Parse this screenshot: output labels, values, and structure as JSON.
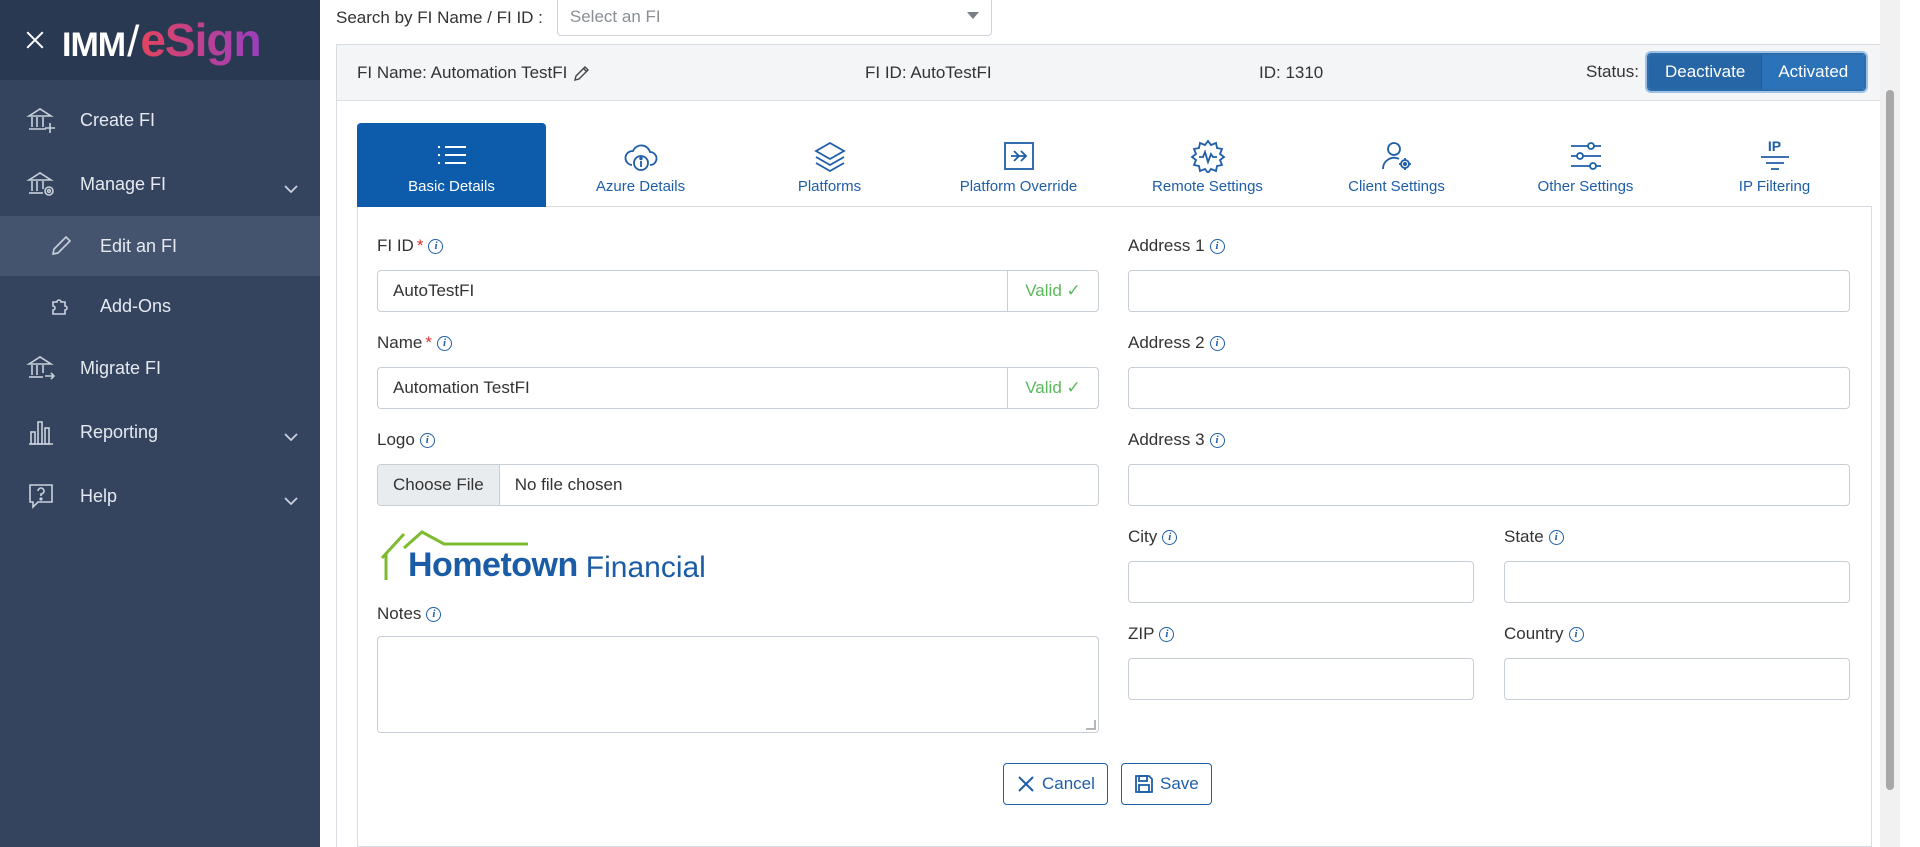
{
  "sidebar": {
    "brand": {
      "imm": "IMM",
      "slash": "/",
      "esign": "eSign"
    },
    "items": [
      {
        "label": "Create FI",
        "icon": "bank-plus-icon"
      },
      {
        "label": "Manage FI",
        "icon": "bank-gear-icon"
      },
      {
        "label": "Edit an FI",
        "icon": "pencil-icon"
      },
      {
        "label": "Add-Ons",
        "icon": "puzzle-icon"
      },
      {
        "label": "Migrate FI",
        "icon": "bank-arrow-icon"
      },
      {
        "label": "Reporting",
        "icon": "bar-chart-icon"
      },
      {
        "label": "Help",
        "icon": "help-bubble-icon"
      }
    ]
  },
  "search": {
    "label": "Search by FI Name / FI ID :",
    "placeholder": "Select an FI"
  },
  "header": {
    "name": "FI Name: Automation TestFI",
    "fi_id": "FI ID: AutoTestFI",
    "id": "ID: 1310",
    "status_label": "Status:",
    "deactivate": "Deactivate",
    "activated": "Activated"
  },
  "tabs": [
    {
      "label": "Basic Details",
      "icon": "list-icon"
    },
    {
      "label": "Azure Details",
      "icon": "cloud-info-icon"
    },
    {
      "label": "Platforms",
      "icon": "layers-icon"
    },
    {
      "label": "Platform Override",
      "icon": "override-arrow-icon"
    },
    {
      "label": "Remote Settings",
      "icon": "remote-gear-icon"
    },
    {
      "label": "Client Settings",
      "icon": "user-gear-icon"
    },
    {
      "label": "Other Settings",
      "icon": "sliders-icon"
    },
    {
      "label": "IP Filtering",
      "icon": "ip-filter-icon",
      "icon_text": "IP"
    }
  ],
  "form": {
    "fi_id": {
      "label": "FI ID",
      "required": "*",
      "value": "AutoTestFI",
      "status": "Valid ✓"
    },
    "name": {
      "label": "Name",
      "required": "*",
      "value": "Automation TestFI",
      "status": "Valid ✓"
    },
    "logo": {
      "label": "Logo",
      "button": "Choose File",
      "text": "No file chosen",
      "preview_main": "Hometown",
      "preview_sub": "Financial"
    },
    "notes": {
      "label": "Notes",
      "value": ""
    },
    "address1": {
      "label": "Address 1",
      "value": ""
    },
    "address2": {
      "label": "Address 2",
      "value": ""
    },
    "address3": {
      "label": "Address 3",
      "value": ""
    },
    "city": {
      "label": "City",
      "value": ""
    },
    "state": {
      "label": "State",
      "value": ""
    },
    "zip": {
      "label": "ZIP",
      "value": ""
    },
    "country": {
      "label": "Country",
      "value": ""
    },
    "info_glyph": "i"
  },
  "actions": {
    "cancel": "Cancel",
    "save": "Save"
  },
  "colors": {
    "sidebar": "#34445f",
    "accent": "#0d5cab",
    "valid": "#5cb85c",
    "required": "#d9302c"
  }
}
